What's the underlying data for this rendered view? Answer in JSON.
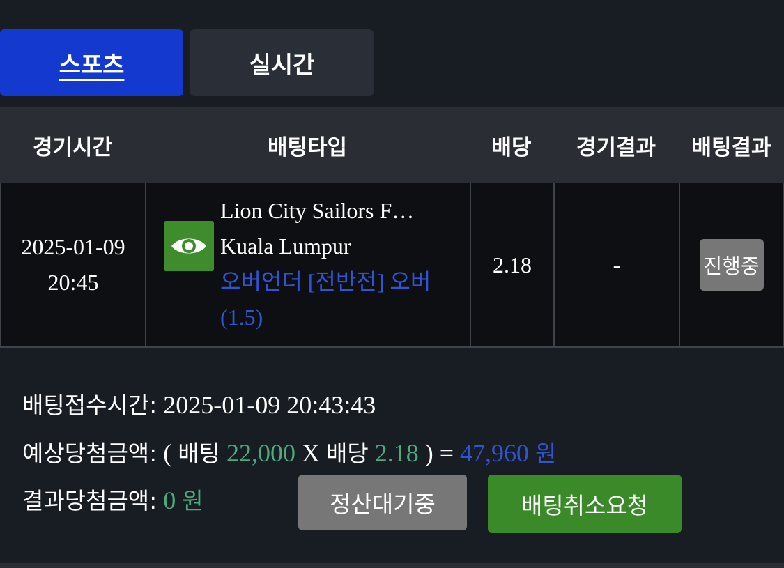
{
  "tabs": [
    {
      "label": "스포츠"
    },
    {
      "label": "실시간"
    }
  ],
  "table": {
    "headers": {
      "time": "경기시간",
      "bet_type": "배팅타입",
      "odds": "배당",
      "match_result": "경기결과",
      "bet_result": "배팅결과"
    },
    "row": {
      "date": "2025-01-09",
      "time": "20:45",
      "home_team": "Lion City Sailors F…",
      "away_team": "Kuala Lumpur",
      "selection": "오버언더 [전반전] 오버 (1.5)",
      "odds": "2.18",
      "match_result": "-",
      "bet_result": "진행중"
    }
  },
  "summary": {
    "bet_time_label": "배팅접수시간:",
    "bet_time_value": "2025-01-09 20:43:43",
    "expected_label": "예상당첨금액:",
    "expected_open": "(",
    "expected_bet_label": "배팅",
    "expected_bet_amount": "22,000",
    "expected_x": "X",
    "expected_odds_label": "배당",
    "expected_odds": "2.18",
    "expected_close": ") =",
    "expected_amount": "47,960",
    "won": "원",
    "result_label": "결과당첨금액:",
    "result_amount": "0",
    "result_won": "원"
  },
  "buttons": {
    "pending": "정산대기중",
    "cancel_request": "배팅취소요청"
  },
  "colors": {
    "tab_active": "#1339cf",
    "green_amount": "#4daa7c",
    "blue_amount": "#2f55d4",
    "cancel_button": "#3a8a2a",
    "pending_button": "#777777"
  }
}
